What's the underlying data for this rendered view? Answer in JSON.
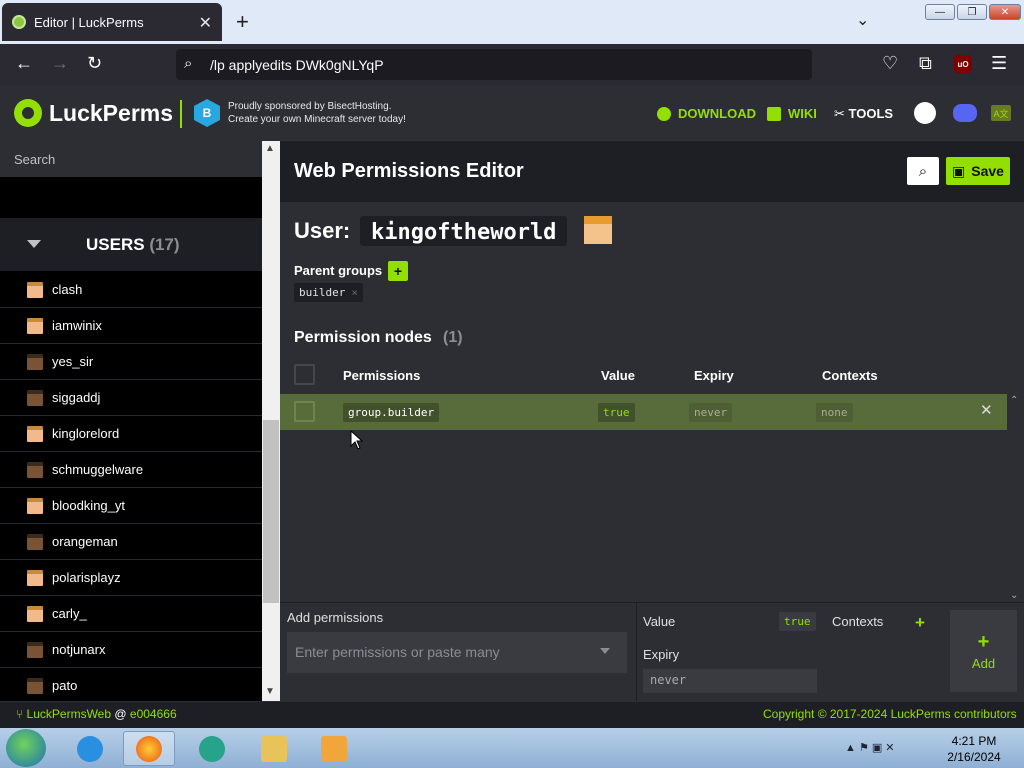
{
  "browser": {
    "tab_title": "Editor | LuckPerms",
    "tab_close": "✕",
    "new_tab": "+",
    "tab_list": "⌄",
    "url": "/lp applyedits DWk0gNLYqP",
    "window_min": "—",
    "window_max": "❐",
    "window_close": "✕",
    "ublock_label": "uO"
  },
  "header": {
    "logo_text": "LuckPerms",
    "sponsor_line1": "Proudly sponsored by BisectHosting.",
    "sponsor_line2": "Create your own Minecraft server today!",
    "nav": {
      "download": "DOWNLOAD",
      "wiki": "WIKI",
      "tools": "TOOLS"
    },
    "translate_label": "A文"
  },
  "sidebar": {
    "search_placeholder": "Search",
    "users_label": "USERS",
    "users_count": "(17)",
    "users": [
      {
        "name": "clash",
        "skin": "#f2b98a"
      },
      {
        "name": "iamwinix",
        "skin": "#f2b98a"
      },
      {
        "name": "yes_sir",
        "skin": "#7a5234"
      },
      {
        "name": "siggaddj",
        "skin": "#7a5234"
      },
      {
        "name": "kinglorelord",
        "skin": "#f2b98a"
      },
      {
        "name": "schmuggelware",
        "skin": "#7a5234"
      },
      {
        "name": "bloodking_yt",
        "skin": "#f2b98a"
      },
      {
        "name": "orangeman",
        "skin": "#7a5234"
      },
      {
        "name": "polarisplayz",
        "skin": "#f2b98a"
      },
      {
        "name": "carly_",
        "skin": "#f2b98a"
      },
      {
        "name": "notjunarx",
        "skin": "#7a5234"
      },
      {
        "name": "pato",
        "skin": "#7a5234"
      }
    ]
  },
  "editor": {
    "title": "Web Permissions Editor",
    "save_label": "Save",
    "user_label": "User:",
    "user_name": "kingoftheworld",
    "parent_groups_label": "Parent groups",
    "parent_add": "+",
    "parent_groups": [
      "builder"
    ],
    "parent_remove": "×",
    "nodes_title": "Permission nodes",
    "nodes_count": "(1)",
    "columns": {
      "permissions": "Permissions",
      "value": "Value",
      "expiry": "Expiry",
      "contexts": "Contexts"
    },
    "nodes": [
      {
        "permission": "group.builder",
        "value": "true",
        "expiry": "never",
        "contexts": "none"
      }
    ],
    "node_delete": "✕"
  },
  "add_panel": {
    "label": "Add permissions",
    "placeholder": "Enter permissions or paste many",
    "value_label": "Value",
    "value_chip": "true",
    "expiry_label": "Expiry",
    "expiry_value": "never",
    "contexts_label": "Contexts",
    "contexts_add": "+",
    "add_plus": "+",
    "add_label": "Add"
  },
  "footer": {
    "left_prefix": "LuckPermsWeb",
    "left_at": "@",
    "left_commit": "e004666",
    "right": "Copyright © 2017-2024 LuckPerms contributors"
  },
  "taskbar": {
    "time": "4:21 PM",
    "date": "2/16/2024"
  },
  "colors": {
    "accent": "#94df03",
    "header_bg": "#2d2e33",
    "page_bg": "#1e1f24",
    "node_row_bg": "#586b3b"
  }
}
